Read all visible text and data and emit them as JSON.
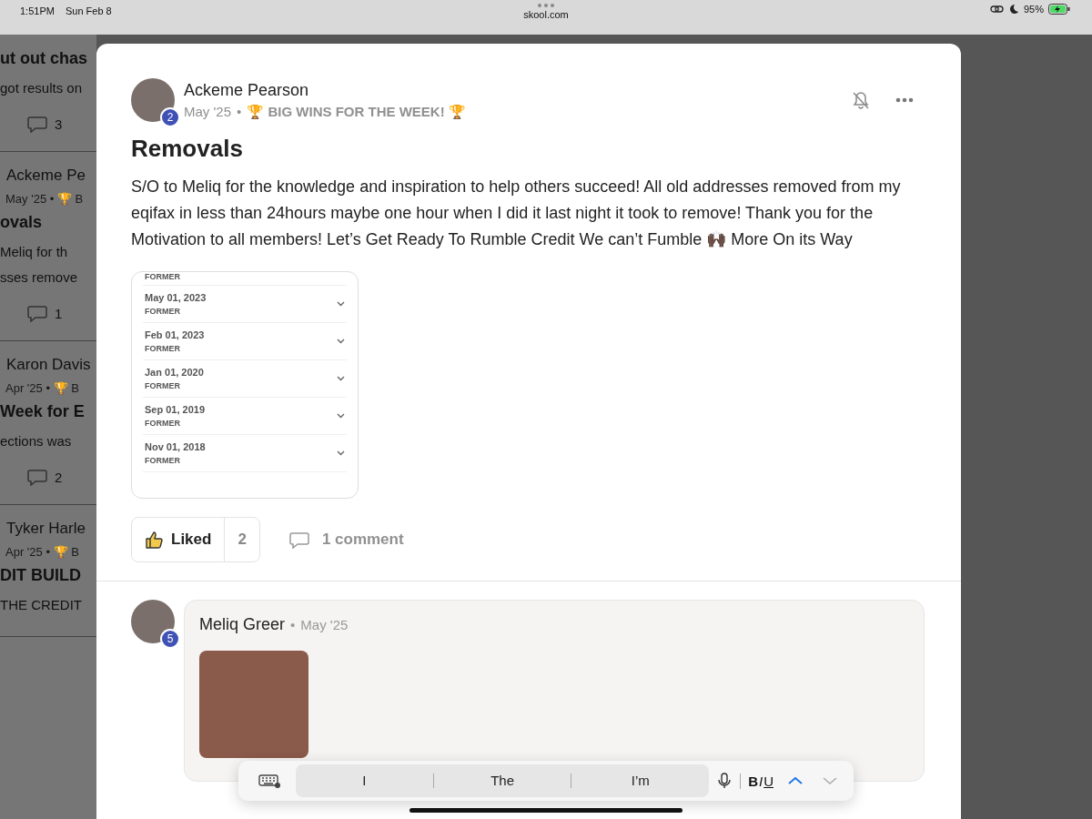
{
  "status_bar": {
    "time": "1:51PM",
    "date": "Sun Feb 8",
    "url": "skool.com",
    "battery": "95%"
  },
  "background_feed": [
    {
      "title": "ut out chas",
      "excerpt": "got results on",
      "comments": "3"
    },
    {
      "author": "Ackeme Pe",
      "meta": "May '25 • 🏆 B",
      "title": "ovals",
      "excerpt": "Meliq for th\nsses remove",
      "comments": "1"
    },
    {
      "author": "Karon Davis",
      "meta": "Apr '25 • 🏆 B",
      "title": "Week for E",
      "excerpt": "ections was",
      "comments": "2"
    },
    {
      "author": "Tyker Harle",
      "meta": "Apr '25 • 🏆 B",
      "title": "DIT BUILD",
      "excerpt": "THE CREDIT"
    }
  ],
  "post": {
    "author": "Ackeme Pearson",
    "rank": "2",
    "date": "May '25",
    "separator": "•",
    "category": "🏆 BIG WINS FOR THE WEEK! 🏆",
    "title": "Removals",
    "body": "S/O to Meliq for the knowledge and inspiration to help others succeed! All old addresses removed from my eqifax in less than 24hours maybe one hour when I did it last night it took to remove! Thank you for the Motivation to all members! Let’s Get Ready To Rumble Credit We can’t Fumble 🙌🏿 More On its Way",
    "attachment_rows": [
      {
        "label": "FORMER"
      },
      {
        "date": "May 01, 2023",
        "label": "FORMER"
      },
      {
        "date": "Feb 01, 2023",
        "label": "FORMER"
      },
      {
        "date": "Jan 01, 2020",
        "label": "FORMER"
      },
      {
        "date": "Sep 01, 2019",
        "label": "FORMER"
      },
      {
        "date": "Nov 01, 2018",
        "label": "FORMER"
      }
    ],
    "like": {
      "label": "Liked",
      "count": "2",
      "liked": true
    },
    "comments_label": "1 comment"
  },
  "comments": [
    {
      "author": "Meliq Greer",
      "rank": "5",
      "separator": "•",
      "date": "May '25"
    }
  ],
  "keyboard_bar": {
    "suggestions": [
      {
        "label": "I"
      },
      {
        "label": "The"
      },
      {
        "label": "I’m"
      }
    ],
    "format_buttons": [
      {
        "kind": "bold",
        "label": "B"
      },
      {
        "kind": "italic",
        "label": "I"
      },
      {
        "kind": "underline",
        "label": "U"
      }
    ]
  }
}
